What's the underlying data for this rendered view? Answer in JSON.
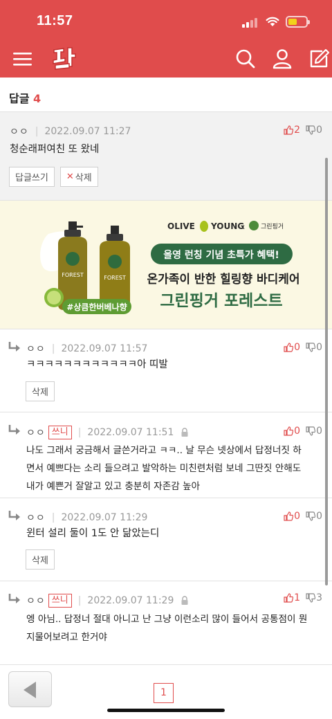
{
  "status": {
    "time": "11:57"
  },
  "header": {
    "menu_icon": "hamburger-menu-icon",
    "logo_text": "판",
    "search_icon": "search-icon",
    "user_icon": "user-icon",
    "write_icon": "edit-icon"
  },
  "reply_section": {
    "title": "답글",
    "count": "4"
  },
  "comments": [
    {
      "nick": "ㅇㅇ",
      "badge": "",
      "date": "2022.09.07 11:27",
      "up": "2",
      "down": "0",
      "text": "청순래퍼여친 또 왔네",
      "reply_btn": "답글쓰기",
      "delete_btn": "삭제"
    },
    {
      "nick": "ㅇㅇ",
      "badge": "",
      "date": "2022.09.07 11:57",
      "up": "0",
      "down": "0",
      "text": "ㅋㅋㅋㅋㅋㅋㅋㅋㅋㅋㅋㅋ아 띠발",
      "delete_btn": "삭제"
    },
    {
      "nick": "ㅇㅇ",
      "badge": "쓰니",
      "date": "2022.09.07 11:51",
      "up": "0",
      "down": "0",
      "text_lines": [
        "나도 그래서 궁금해서 글쓴거라고 ㅋㅋ.. 날 무슨 넷상에서 답정너짓 하",
        "면서 예쁘다는 소리 들으려고 발악하는 미친련처럼 보네 그딴짓 안해도",
        "내가 예쁜거 잘알고 있고 충분히 자존감 높아"
      ]
    },
    {
      "nick": "ㅇㅇ",
      "badge": "",
      "date": "2022.09.07 11:29",
      "up": "0",
      "down": "0",
      "text": "윈터 설리 둘이 1도 안 닮았는디",
      "delete_btn": "삭제"
    },
    {
      "nick": "ㅇㅇ",
      "badge": "쓰니",
      "date": "2022.09.07 11:29",
      "up": "1",
      "down": "3",
      "text_lines": [
        "엥 아님.. 답정너 절대 아니고 난 그냥 이런소리 많이 들어서 공통점이 뭔",
        "지물어보려고 한거야"
      ]
    }
  ],
  "ad": {
    "brand_left": "OLIVE",
    "brand_mid": "YOUNG",
    "times": "x",
    "partner": "그린핑거",
    "pill": "올영 런칭 기념 초특가 혜택!",
    "line1": "온가족이 반한 힐링향 바디케어",
    "line2": "그린핑거 포레스트",
    "tag": "#상큼한버베나향",
    "bottle_label": "FOREST"
  },
  "pagination": {
    "current": "1",
    "back_icon": "back-arrow-icon"
  }
}
